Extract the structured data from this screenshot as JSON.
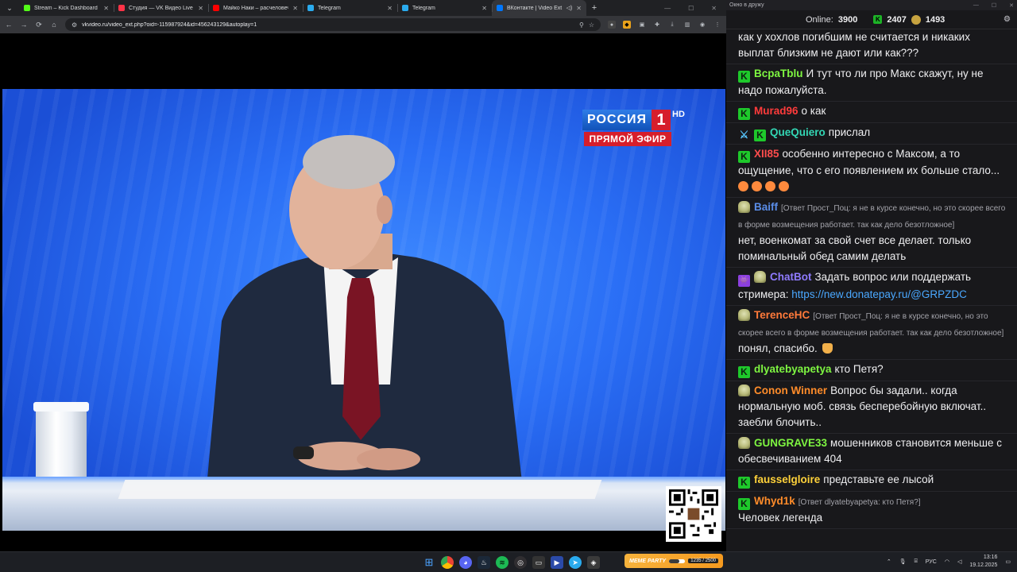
{
  "browser": {
    "tabs": [
      {
        "label": "Stream – Kick Dashboard",
        "favicon": "kick-icon",
        "color": "#53fc18",
        "active": false
      },
      {
        "label": "Студия — VK Видео Live",
        "favicon": "vk-live-icon",
        "color": "#ff3347",
        "active": false
      },
      {
        "label": "Майко Наки – расчеловечивание",
        "favicon": "youtube-icon",
        "color": "#ff0000",
        "active": false
      },
      {
        "label": "Telegram",
        "favicon": "telegram-icon",
        "color": "#2aabee",
        "active": false
      },
      {
        "label": "Telegram",
        "favicon": "telegram-icon",
        "color": "#2aabee",
        "active": false
      },
      {
        "label": "ВКонтакте | Video Ext",
        "favicon": "vk-icon",
        "color": "#0077ff",
        "active": true
      }
    ],
    "url": "vkvideo.ru/video_ext.php?oid=-115987924&id=456243129&autoplay=1"
  },
  "video": {
    "channel_name": "РОССИЯ",
    "channel_number": "1",
    "hd_mark": "HD",
    "live_label": "ПРЯМОЙ ЭФИР"
  },
  "chat_window": {
    "title": "Окно в дружу",
    "online_label": "Online:",
    "online_count": "3900",
    "kick_count": "2407",
    "coin_count": "1493"
  },
  "chat": [
    {
      "badges": [],
      "user": "",
      "user_color": "#efeff1",
      "reply": "",
      "text": "как у хохлов погибшим не считается и никаких выплат близким не дают или как???"
    },
    {
      "badges": [
        "kick"
      ],
      "user": "BcpaTblu",
      "user_color": "#7ef541",
      "reply": "",
      "text": "И тут что ли про Макс скажут, ну не надо пожалуйста."
    },
    {
      "badges": [
        "kick"
      ],
      "user": "Murad96",
      "user_color": "#ff3b3b",
      "reply": "",
      "text": "о как"
    },
    {
      "badges": [
        "sword",
        "kick"
      ],
      "user": "QueQuiero",
      "user_color": "#33d6b4",
      "reply": "",
      "text": "прислал"
    },
    {
      "badges": [
        "kick"
      ],
      "user": "XII85",
      "user_color": "#ff4d4d",
      "reply": "",
      "text": "особенно интересно с Максом, а то ощущение, что с его появлением их больше стало..."
    },
    {
      "badges": [
        "skull"
      ],
      "user": "Baiff",
      "user_color": "#5a8de8",
      "reply": "[Ответ Прост_Поц: я не в курсе конечно, но это скорее всего в форме возмещения работает. так как дело безотложное]",
      "text": "нет, военкомат за свой счет все делает. только поминальный обед самим делать"
    },
    {
      "badges": [
        "bot",
        "skull"
      ],
      "user": "ChatBot",
      "user_color": "#8f7bff",
      "reply": "",
      "text": "Задать вопрос или поддержать стримера: ",
      "link": "https://new.donatepay.ru/@GRPZDC"
    },
    {
      "badges": [
        "skull"
      ],
      "user": "TerenceHC",
      "user_color": "#ff7a3a",
      "reply": "[Ответ Прост_Поц: я не в курсе конечно, но это скорее всего в форме возмещения работает. так как дело безотложное]",
      "text": "понял, спасибо."
    },
    {
      "badges": [
        "kick"
      ],
      "user": "dlyatebyapetya",
      "user_color": "#7ef541",
      "reply": "",
      "text": "кто Петя?"
    },
    {
      "badges": [
        "skull"
      ],
      "user": "Conon Winner",
      "user_color": "#ff8c2a",
      "reply": "",
      "text": "Вопрос бы задали.. когда нормальную моб. связь бесперебойную включат.. заебли блочить.."
    },
    {
      "badges": [
        "skull"
      ],
      "user": "GUNGRAVE33",
      "user_color": "#7ef541",
      "reply": "",
      "text": "мошенников становится меньше с обесвечиванием 404"
    },
    {
      "badges": [
        "kick"
      ],
      "user": "fausselgloire",
      "user_color": "#ffd23a",
      "reply": "",
      "text": "представьте ее лысой"
    },
    {
      "badges": [
        "kick"
      ],
      "user": "Whyd1k",
      "user_color": "#ff8c2a",
      "reply": "[Ответ dlyatebyapetya: кто Петя?]",
      "text": "Человек легенда"
    }
  ],
  "taskbar": {
    "lang": "РУС",
    "time": "13:16",
    "date": "19.12.2025",
    "party_title": "MEME PARTY",
    "party_progress": 0.62,
    "party_count": "1235 / 2500"
  }
}
